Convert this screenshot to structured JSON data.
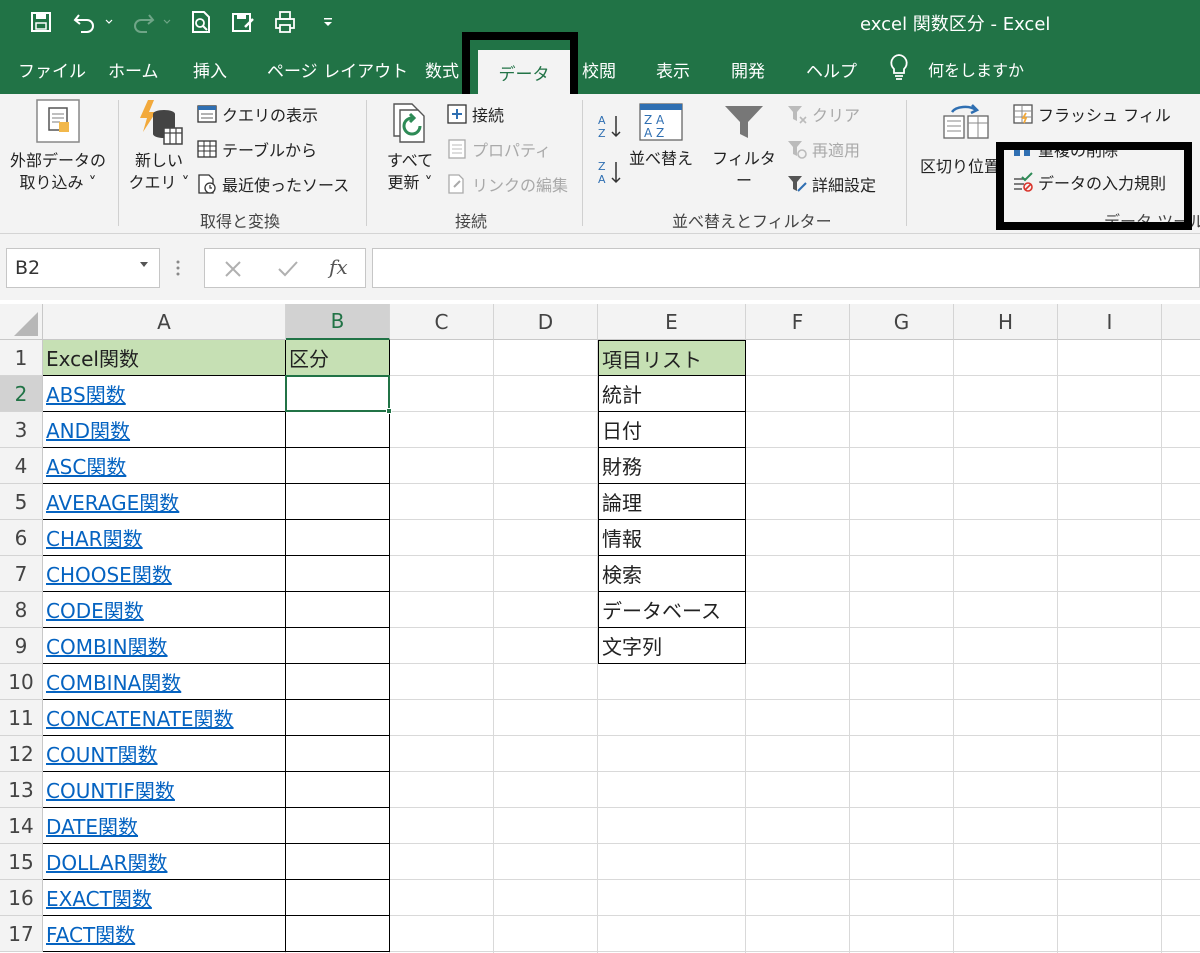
{
  "window": {
    "title": "excel 関数区分 - Excel"
  },
  "quick_access": {
    "icons": [
      "save-icon",
      "undo-icon",
      "redo-icon",
      "print-preview-icon",
      "save-as-icon",
      "quick-print-icon",
      "customize-qat-icon"
    ]
  },
  "tabs": [
    {
      "label": "ファイル"
    },
    {
      "label": "ホーム"
    },
    {
      "label": "挿入"
    },
    {
      "label": "ページ レイアウト"
    },
    {
      "label": "数式"
    },
    {
      "label": "データ"
    },
    {
      "label": "校閲"
    },
    {
      "label": "表示"
    },
    {
      "label": "開発"
    },
    {
      "label": "ヘルプ"
    }
  ],
  "tell_me": "何をしますか",
  "ribbon": {
    "external_data": {
      "line1": "外部データの",
      "line2": "取り込み"
    },
    "new_query": {
      "line1": "新しい",
      "line2": "クエリ"
    },
    "show_queries": "クエリの表示",
    "from_table": "テーブルから",
    "recent_sources": "最近使ったソース",
    "group_get_transform": "取得と変換",
    "refresh_all": {
      "line1": "すべて",
      "line2": "更新"
    },
    "connections": "接続",
    "properties": "プロパティ",
    "edit_links": "リンクの編集",
    "group_connections": "接続",
    "sort": "並べ替え",
    "filter": "フィルター",
    "clear": "クリア",
    "reapply": "再適用",
    "advanced": "詳細設定",
    "group_sort_filter": "並べ替えとフィルター",
    "text_to_columns": "区切り位置",
    "flash_fill": "フラッシュ フィル",
    "remove_duplicates": "重複の削除",
    "data_validation": "データの入力規則",
    "group_data_tools": "データ ツール"
  },
  "formula_bar": {
    "name_box": "B2",
    "formula": ""
  },
  "colors": {
    "excel_green": "#217346",
    "header_fill": "#c6e0b4",
    "link": "#0563c1"
  },
  "sheet": {
    "columns": [
      "A",
      "B",
      "C",
      "D",
      "E",
      "F",
      "G",
      "H",
      "I"
    ],
    "selected_column": "B",
    "selected_row": "2",
    "rows": [
      "1",
      "2",
      "3",
      "4",
      "5",
      "6",
      "7",
      "8",
      "9",
      "10",
      "11",
      "12",
      "13",
      "14",
      "15",
      "16",
      "17"
    ],
    "header_a": "Excel関数",
    "header_b": "区分",
    "header_e": "項目リスト",
    "functions": [
      "ABS関数",
      "AND関数",
      "ASC関数",
      "AVERAGE関数",
      "CHAR関数",
      "CHOOSE関数",
      "CODE関数",
      "COMBIN関数",
      "COMBINA関数",
      "CONCATENATE関数",
      "COUNT関数",
      "COUNTIF関数",
      "DATE関数",
      "DOLLAR関数",
      "EXACT関数",
      "FACT関数"
    ],
    "categories": [
      "統計",
      "日付",
      "財務",
      "論理",
      "情報",
      "検索",
      "データベース",
      "文字列"
    ]
  }
}
